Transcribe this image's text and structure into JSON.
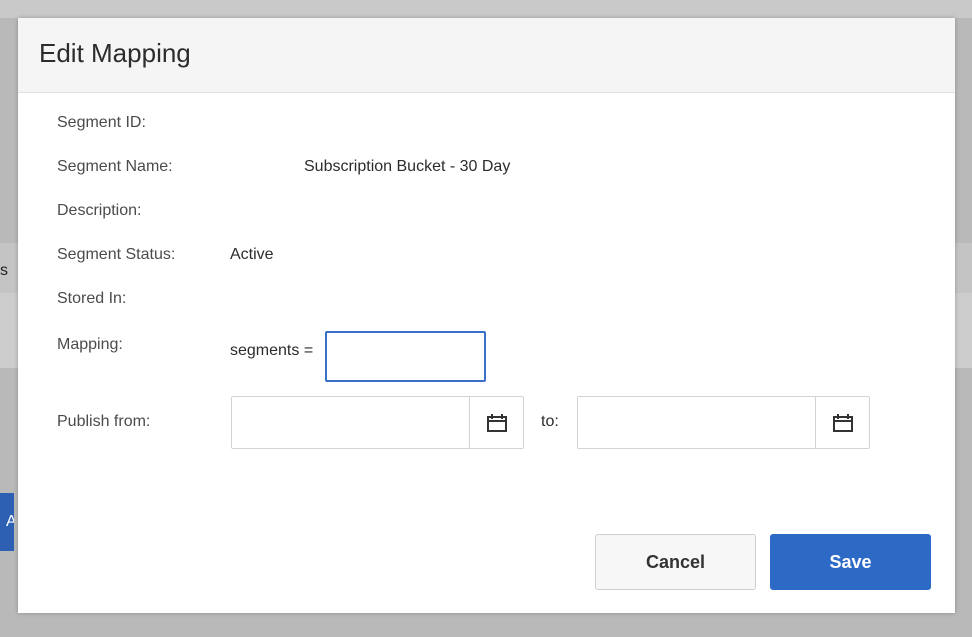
{
  "dialog": {
    "title": "Edit Mapping"
  },
  "fields": {
    "segment_id": {
      "label": "Segment ID:",
      "value": ""
    },
    "segment_name": {
      "label": "Segment Name:",
      "value": "Subscription Bucket - 30 Day"
    },
    "description": {
      "label": "Description:",
      "value": ""
    },
    "segment_status": {
      "label": "Segment Status:",
      "value": "Active"
    },
    "stored_in": {
      "label": "Stored In:",
      "value": ""
    },
    "mapping": {
      "label": "Mapping:",
      "prefix": "segments =",
      "value": ""
    },
    "publish": {
      "label": "Publish from:",
      "from_value": "",
      "to_label": "to:",
      "to_value": ""
    }
  },
  "buttons": {
    "cancel": "Cancel",
    "save": "Save"
  },
  "background": {
    "fragment_text": "s",
    "blue_button_text": "A"
  },
  "icons": {
    "calendar": "calendar-icon"
  },
  "colors": {
    "accent": "#2d6ac6",
    "focus_border": "#3a6fc8",
    "backdrop": "#b9b9b9"
  }
}
